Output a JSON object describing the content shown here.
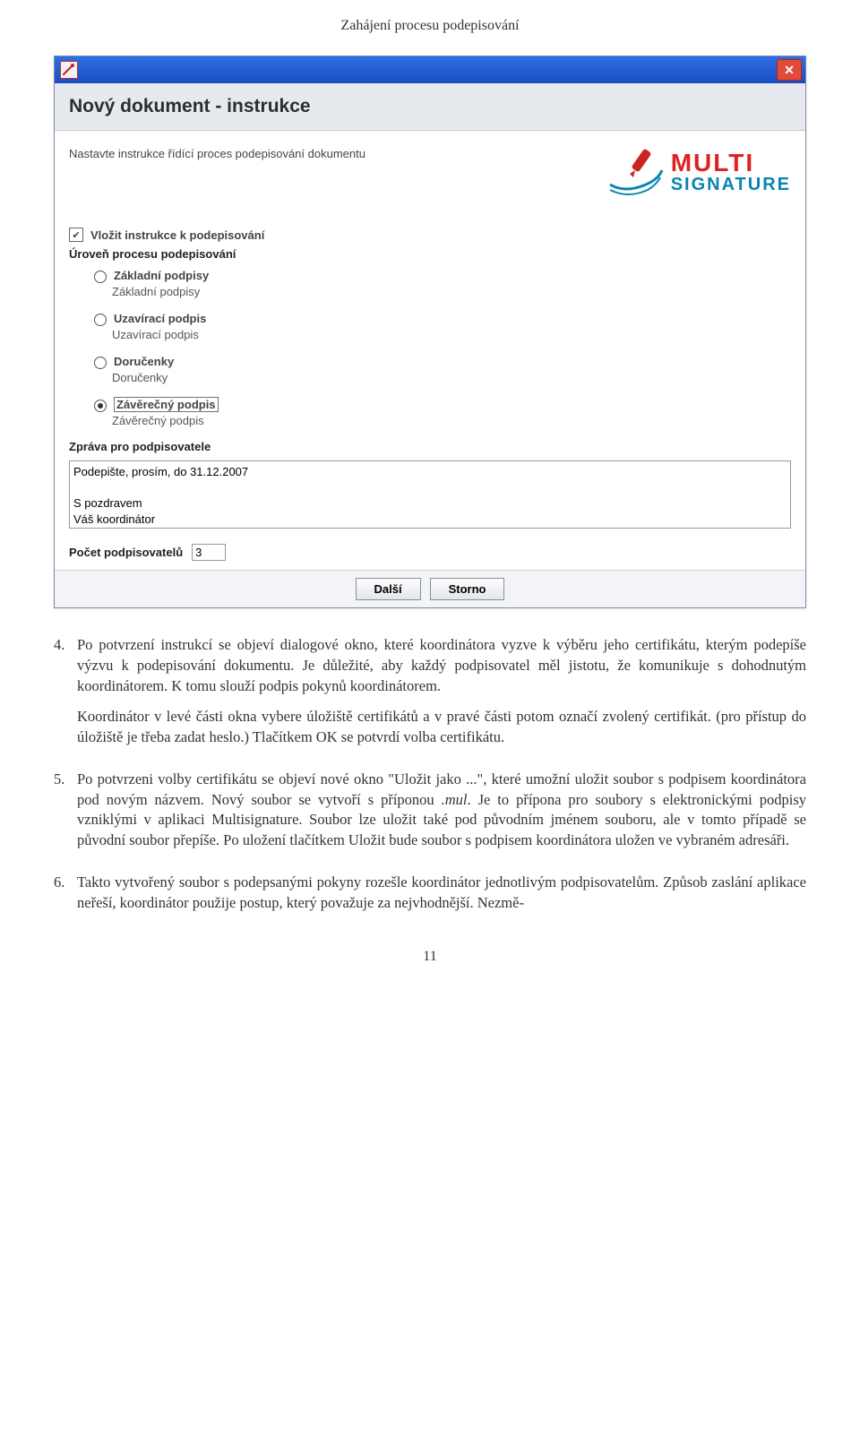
{
  "header": "Zahájení procesu podepisování",
  "dialog": {
    "title": "Nový dokument - instrukce",
    "intro": "Nastavte instrukce řídící proces podepisování dokumentu",
    "logo": {
      "line1": "MULTI",
      "line2": "SIGNATURE"
    },
    "checkbox_label": "Vložit instrukce k podepisování",
    "level_heading": "Úroveň procesu podepisování",
    "radios": [
      {
        "label": "Základní podpisy",
        "desc": "Základní podpisy",
        "selected": false
      },
      {
        "label": "Uzavírací podpis",
        "desc": "Uzavírací podpis",
        "selected": false
      },
      {
        "label": "Doručenky",
        "desc": "Doručenky",
        "selected": false
      },
      {
        "label": "Závěrečný podpis",
        "desc": "Závěrečný podpis",
        "selected": true
      }
    ],
    "message_heading": "Zpráva pro podpisovatele",
    "message_value": "Podepište, prosím, do 31.12.2007\n\nS pozdravem\nVáš koordinátor",
    "count_label": "Počet podpisovatelů",
    "count_value": "3",
    "btn_next": "Další",
    "btn_cancel": "Storno"
  },
  "items": {
    "4": {
      "marker": "4.",
      "para1": "Po potvrzení instrukcí se objeví dialogové okno, které koordinátora vyzve k výběru jeho certifikátu, kterým podepíše výzvu k podepisování dokumentu. Je důležité, aby každý podpisovatel měl jistotu, že komunikuje s dohodnutým koordinátorem. K tomu slouží podpis pokynů koordinátorem.",
      "para2": "Koordinátor v levé části okna vybere úložiště certifikátů a v pravé části potom označí zvolený certifikát. (pro přístup do úložiště je třeba zadat heslo.) Tlačítkem OK se potvrdí volba certifikátu."
    },
    "5": {
      "marker": "5.",
      "para": "Po potvrzeni volby certifikátu se objeví nové okno \"Uložit jako ...\", které umožní uložit soubor s podpisem koordinátora pod novým názvem. Nový soubor se vytvoří s příponou ",
      "mul": ".mul",
      "cont": ". Je to přípona pro soubory s elektronickými podpisy vzniklými v aplikaci Multisignature. Soubor lze uložit také pod původním jménem souboru, ale v tomto případě se původní soubor přepíše. Po uložení tlačítkem Uložit bude soubor s podpisem koordinátora uložen ve vybraném adresáři."
    },
    "6": {
      "marker": "6.",
      "para": "Takto vytvořený soubor s podepsanými pokyny rozešle koordinátor jednotlivým podpisovatelům. Způsob zaslání aplikace neřeší, koordinátor použije postup, který považuje za nejvhodnější. Nezmě-"
    }
  },
  "page_number": "11"
}
